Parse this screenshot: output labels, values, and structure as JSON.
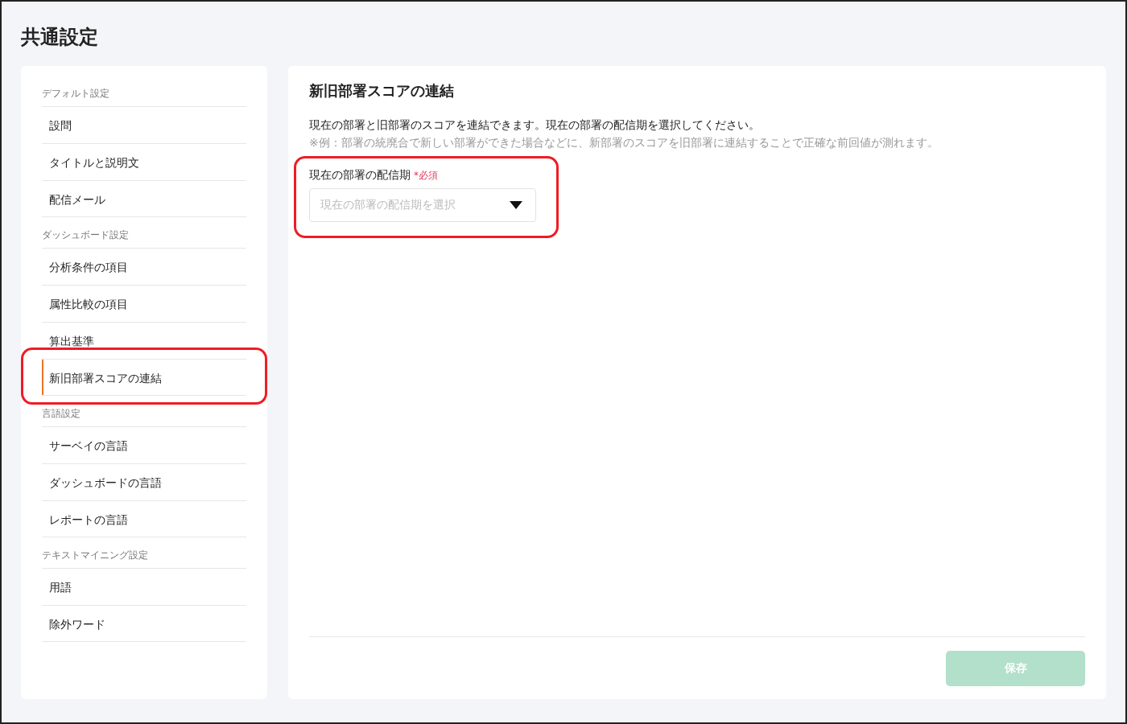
{
  "page_title": "共通設定",
  "sidebar": {
    "groups": [
      {
        "heading": "デフォルト設定",
        "items": [
          {
            "label": "設問",
            "selected": false,
            "highlighted": false
          },
          {
            "label": "タイトルと説明文",
            "selected": false,
            "highlighted": false
          },
          {
            "label": "配信メール",
            "selected": false,
            "highlighted": false
          }
        ]
      },
      {
        "heading": "ダッシュボード設定",
        "items": [
          {
            "label": "分析条件の項目",
            "selected": false,
            "highlighted": false
          },
          {
            "label": "属性比較の項目",
            "selected": false,
            "highlighted": false
          },
          {
            "label": "算出基準",
            "selected": false,
            "highlighted": false
          },
          {
            "label": "新旧部署スコアの連結",
            "selected": true,
            "highlighted": true
          }
        ]
      },
      {
        "heading": "言語設定",
        "items": [
          {
            "label": "サーベイの言語",
            "selected": false,
            "highlighted": false
          },
          {
            "label": "ダッシュボードの言語",
            "selected": false,
            "highlighted": false
          },
          {
            "label": "レポートの言語",
            "selected": false,
            "highlighted": false
          }
        ]
      },
      {
        "heading": "テキストマイニング設定",
        "items": [
          {
            "label": "用語",
            "selected": false,
            "highlighted": false
          },
          {
            "label": "除外ワード",
            "selected": false,
            "highlighted": false
          }
        ]
      }
    ]
  },
  "panel": {
    "title": "新旧部署スコアの連結",
    "description": "現在の部署と旧部署のスコアを連結できます。現在の部署の配信期を選択してください。",
    "note": "※例：部署の統廃合で新しい部署ができた場合などに、新部署のスコアを旧部署に連結することで正確な前回値が測れます。",
    "field": {
      "label": "現在の部署の配信期",
      "required": "*必須",
      "placeholder": "現在の部署の配信期を選択",
      "highlighted": true
    },
    "save_button": {
      "label": "保存",
      "disabled": true
    }
  }
}
